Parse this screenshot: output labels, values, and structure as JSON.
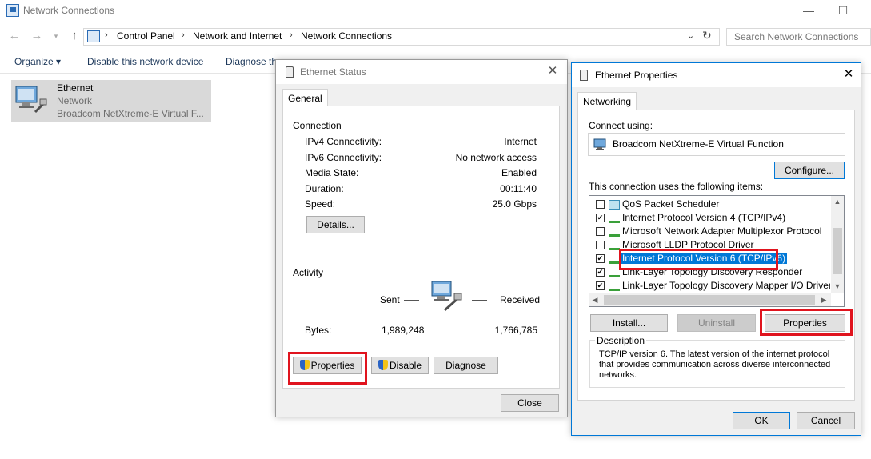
{
  "explorer": {
    "title": "Network Connections",
    "address": [
      "Control Panel",
      "Network and Internet",
      "Network Connections"
    ],
    "search_placeholder": "Search Network Connections",
    "commands": [
      "Organize ▾",
      "Disable this network device",
      "Diagnose th"
    ],
    "adapter": {
      "name": "Ethernet",
      "status": "Network",
      "device": "Broadcom NetXtreme-E Virtual F..."
    }
  },
  "status_dialog": {
    "title": "Ethernet Status",
    "tab": "General",
    "connection_label": "Connection",
    "rows": [
      {
        "key": "IPv4 Connectivity:",
        "value": "Internet"
      },
      {
        "key": "IPv6 Connectivity:",
        "value": "No network access"
      },
      {
        "key": "Media State:",
        "value": "Enabled"
      },
      {
        "key": "Duration:",
        "value": "00:11:40"
      },
      {
        "key": "Speed:",
        "value": "25.0 Gbps"
      }
    ],
    "details_button": "Details...",
    "activity_label": "Activity",
    "sent_label": "Sent",
    "received_label": "Received",
    "bytes_label": "Bytes:",
    "bytes_sent": "1,989,248",
    "bytes_received": "1,766,785",
    "properties_button": "Properties",
    "disable_button": "Disable",
    "diagnose_button": "Diagnose",
    "close_button": "Close"
  },
  "props_dialog": {
    "title": "Ethernet Properties",
    "tab": "Networking",
    "connect_using_label": "Connect using:",
    "adapter_name": "Broadcom NetXtreme-E Virtual Function",
    "configure_button": "Configure...",
    "items_label": "This connection uses the following items:",
    "items": [
      {
        "label": "QoS Packet Scheduler",
        "checked": false
      },
      {
        "label": "Internet Protocol Version 4 (TCP/IPv4)",
        "checked": true
      },
      {
        "label": "Microsoft Network Adapter Multiplexor Protocol",
        "checked": false
      },
      {
        "label": "Microsoft LLDP Protocol Driver",
        "checked": false
      },
      {
        "label": "Internet Protocol Version 6 (TCP/IPv6)",
        "checked": true,
        "selected": true
      },
      {
        "label": "Link-Layer Topology Discovery Responder",
        "checked": true
      },
      {
        "label": "Link-Layer Topology Discovery Mapper I/O Driver",
        "checked": true
      }
    ],
    "install_button": "Install...",
    "uninstall_button": "Uninstall",
    "properties_button": "Properties",
    "description_label": "Description",
    "description_text": "TCP/IP version 6. The latest version of the internet protocol that provides communication across diverse interconnected networks.",
    "ok_button": "OK",
    "cancel_button": "Cancel"
  },
  "colors": {
    "highlight": "#e0141e",
    "selection": "#0078d7"
  }
}
